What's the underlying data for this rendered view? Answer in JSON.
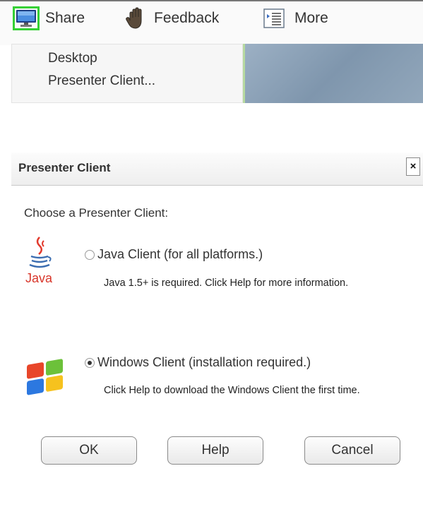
{
  "toolbar": {
    "share_label": "Share",
    "feedback_label": "Feedback",
    "more_label": "More",
    "share_icon": "monitor-icon",
    "feedback_icon": "raised-hand-icon",
    "more_icon": "list-icon",
    "selected_highlight_color": "#35d035"
  },
  "share_menu": {
    "items": [
      "Desktop",
      "Presenter Client..."
    ]
  },
  "dialog": {
    "title": "Presenter Client",
    "close_symbol": "×",
    "prompt": "Choose a Presenter Client:",
    "options": [
      {
        "label": "Java Client (for all platforms.)",
        "description": "Java 1.5+ is required. Click Help for more information.",
        "selected": false,
        "icon": "java-logo-icon",
        "icon_text": "Java"
      },
      {
        "label": "Windows Client (installation required.)",
        "description": "Click Help to download the Windows Client the first time.",
        "selected": true,
        "icon": "windows-logo-icon"
      }
    ],
    "buttons": {
      "ok": "OK",
      "help": "Help",
      "cancel": "Cancel"
    }
  }
}
